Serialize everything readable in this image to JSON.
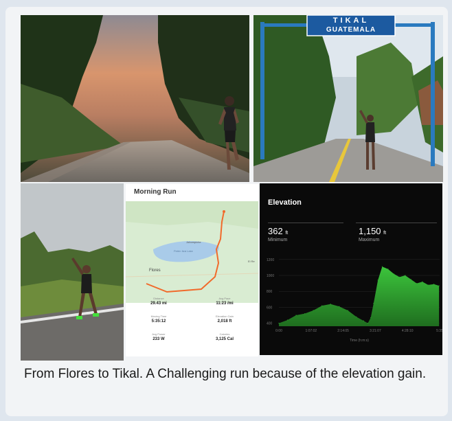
{
  "photos": {
    "sign_line1": "TIKAL",
    "sign_line2": "GUATEMALA"
  },
  "strava": {
    "title": "Morning Run",
    "map": {
      "label_flores": "Flores",
      "label_lake": "Petén Itzá Lake",
      "label_town": "Jobompiche",
      "label_road": "El Re"
    },
    "stats": [
      {
        "label": "Distance",
        "value": "29.43 mi"
      },
      {
        "label": "Avg Pace",
        "value": "11:23 /mi"
      },
      {
        "label": "Moving Time",
        "value": "5:35:12"
      },
      {
        "label": "Elevation Gain",
        "value": "2,018 ft"
      },
      {
        "label": "Avg Power",
        "value": "233 W"
      },
      {
        "label": "Calories",
        "value": "3,125 Cal"
      }
    ]
  },
  "elevation": {
    "title": "Elevation",
    "min_value": "362",
    "min_unit": "ft",
    "min_label": "Minimum",
    "max_value": "1,150",
    "max_unit": "ft",
    "max_label": "Maximum",
    "xlabel": "Time (h:m:s)"
  },
  "chart_data": {
    "type": "area",
    "title": "Elevation",
    "xlabel": "Time (h:m:s)",
    "ylabel": "",
    "x_ticks": [
      "0:00",
      "1:07:02",
      "2:14:05",
      "3:21:07",
      "4:28:10",
      "5:35"
    ],
    "y_ticks": [
      400,
      600,
      800,
      1000,
      1200
    ],
    "ylim": [
      362,
      1250
    ],
    "xlim": [
      0,
      5.6
    ],
    "color": "#2ca02c",
    "x": [
      0,
      0.3,
      0.6,
      0.9,
      1.2,
      1.5,
      1.8,
      2.1,
      2.4,
      2.7,
      2.95,
      3.1,
      3.2,
      3.3,
      3.45,
      3.6,
      3.8,
      4.0,
      4.2,
      4.4,
      4.6,
      4.8,
      5.0,
      5.2,
      5.4,
      5.58
    ],
    "y": [
      400,
      440,
      500,
      520,
      560,
      620,
      640,
      610,
      560,
      480,
      430,
      400,
      470,
      650,
      940,
      1110,
      1080,
      1020,
      980,
      1000,
      950,
      900,
      920,
      880,
      890,
      870
    ]
  },
  "caption": "From Flores to Tikal.  A Challenging run because of the elevation gain."
}
